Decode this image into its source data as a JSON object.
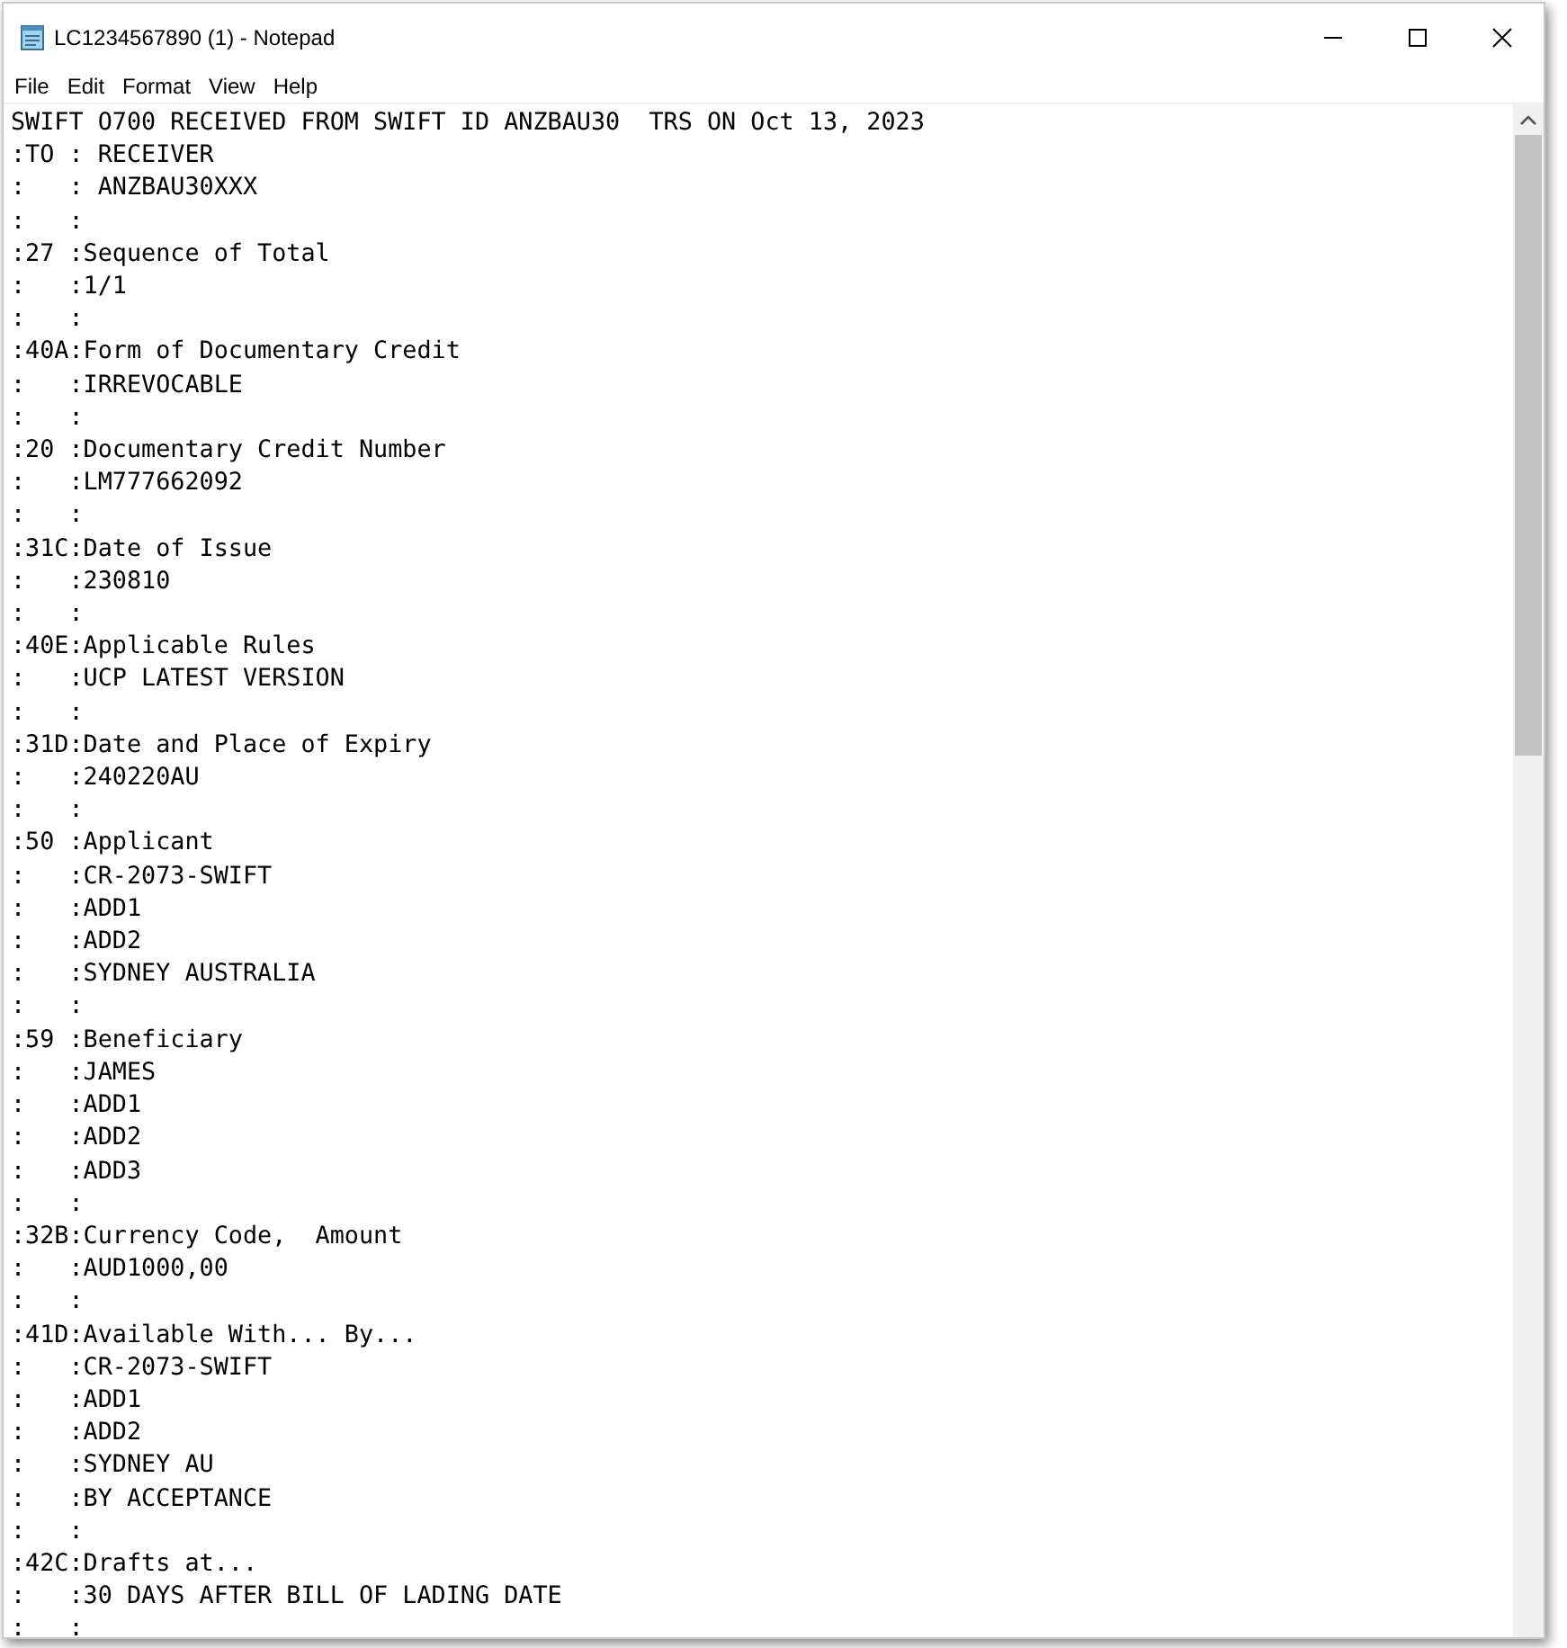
{
  "window": {
    "title": "LC1234567890 (1) - Notepad"
  },
  "menu": [
    "File",
    "Edit",
    "Format",
    "View",
    "Help"
  ],
  "lines": [
    "SWIFT O700 RECEIVED FROM SWIFT ID ANZBAU30  TRS ON Oct 13, 2023",
    ":TO : RECEIVER",
    ":   : ANZBAU30XXX",
    ":   :",
    ":27 :Sequence of Total",
    ":   :1/1",
    ":   :",
    ":40A:Form of Documentary Credit",
    ":   :IRREVOCABLE",
    ":   :",
    ":20 :Documentary Credit Number",
    ":   :LM777662092",
    ":   :",
    ":31C:Date of Issue",
    ":   :230810",
    ":   :",
    ":40E:Applicable Rules",
    ":   :UCP LATEST VERSION",
    ":   :",
    ":31D:Date and Place of Expiry",
    ":   :240220AU",
    ":   :",
    ":50 :Applicant",
    ":   :CR-2073-SWIFT",
    ":   :ADD1",
    ":   :ADD2",
    ":   :SYDNEY AUSTRALIA",
    ":   :",
    ":59 :Beneficiary",
    ":   :JAMES",
    ":   :ADD1",
    ":   :ADD2",
    ":   :ADD3",
    ":   :",
    ":32B:Currency Code,  Amount",
    ":   :AUD1000,00",
    ":   :",
    ":41D:Available With... By...",
    ":   :CR-2073-SWIFT",
    ":   :ADD1",
    ":   :ADD2",
    ":   :SYDNEY AU",
    ":   :BY ACCEPTANCE",
    ":   :",
    ":42C:Drafts at...",
    ":   :30 DAYS AFTER BILL OF LADING DATE",
    ":   :"
  ]
}
